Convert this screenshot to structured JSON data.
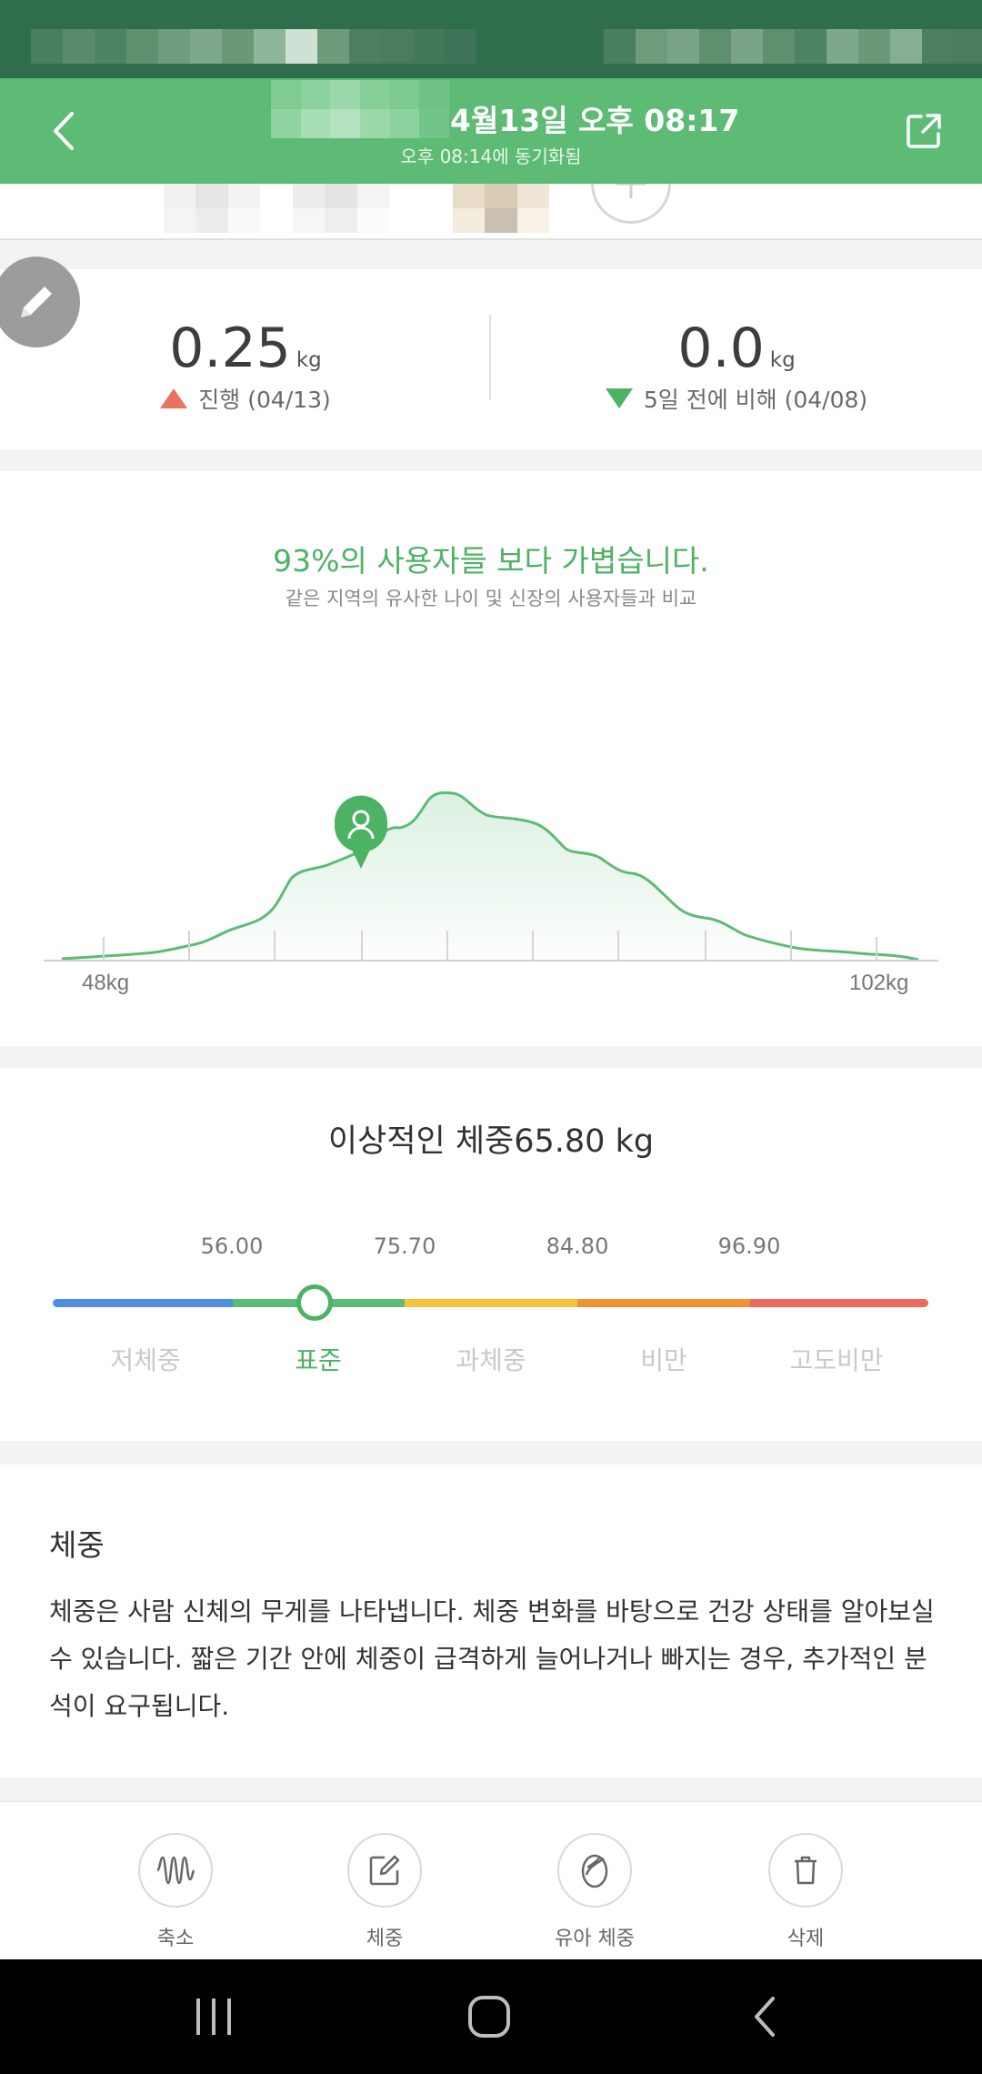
{
  "header": {
    "title": "4월13일 오후 08:17",
    "subtitle": "오후 08:14에 동기화됨",
    "back_icon": "chevron-left-icon",
    "share_icon": "external-link-icon"
  },
  "change": {
    "progress": {
      "value": "0.25",
      "unit": "kg",
      "note": "진행 (04/13)"
    },
    "compare": {
      "value": "0.0",
      "unit": "kg",
      "note": "5일 전에 비해 (04/08)"
    }
  },
  "distribution": {
    "headline": "93%의 사용자들 보다 가볍습니다.",
    "subtitle": "같은 지역의 유사한 나이 및 신장의 사용자들과 비교",
    "min_label": "48kg",
    "max_label": "102kg"
  },
  "ideal": {
    "title": "이상적인 체중65.80 kg",
    "thresholds": [
      "56.00",
      "75.70",
      "84.80",
      "96.90"
    ],
    "categories": [
      "저체중",
      "표준",
      "과체중",
      "비만",
      "고도비만"
    ],
    "active_category": "표준",
    "colors": [
      "#4f8de0",
      "#5dbb76",
      "#f4c43b",
      "#ef9333",
      "#ec6a5a"
    ]
  },
  "description": {
    "title": "체중",
    "text": "체중은 사람 신체의 무게를 나타냅니다. 체중 변화를 바탕으로 건강 상태를 알아보실 수 있습니다. 짧은 기간 안에 체중이 급격하게 늘어나거나 빠지는 경우, 추가적인 분석이 요구됩니다."
  },
  "actions": [
    {
      "label": "축소",
      "icon": "waveform-icon"
    },
    {
      "label": "체중",
      "icon": "edit-icon"
    },
    {
      "label": "유아 체중",
      "icon": "baby-icon"
    },
    {
      "label": "삭제",
      "icon": "trash-icon"
    }
  ],
  "colors": {
    "brand": "#5dbb76",
    "status_bar": "#2f6e4c",
    "up": "#e8735e",
    "down": "#4cb264"
  }
}
